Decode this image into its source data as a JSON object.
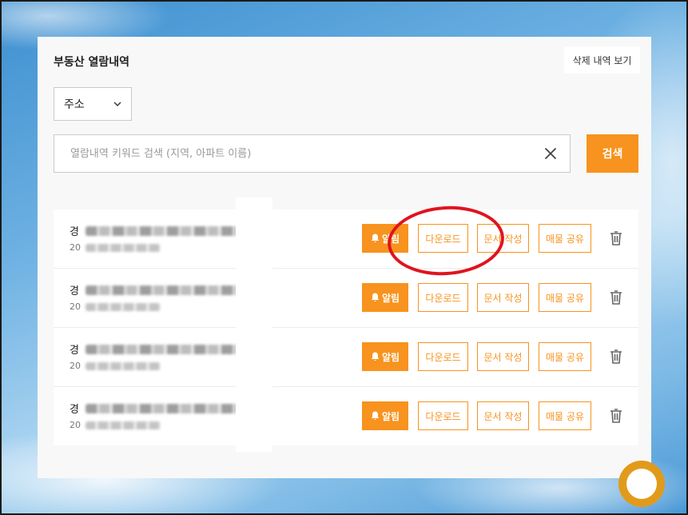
{
  "page": {
    "title": "부동산 열람내역",
    "deleted_history_label": "삭제 내역 보기"
  },
  "filter": {
    "selected": "주소"
  },
  "search": {
    "placeholder": "열람내역 키워드 검색 (지역, 아파트 이름)",
    "value": "",
    "button_label": "검색"
  },
  "records": [
    {
      "address_prefix": "경",
      "date_prefix": "20"
    },
    {
      "address_prefix": "경",
      "date_prefix": "20"
    },
    {
      "address_prefix": "경",
      "date_prefix": "20"
    },
    {
      "address_prefix": "경",
      "date_prefix": "20"
    }
  ],
  "row_actions": {
    "alarm_label": "알림",
    "download_label": "다운로드",
    "write_doc_label": "문서 작성",
    "share_label": "매물 공유"
  },
  "icons": {
    "select": "chevron-down-icon",
    "clear": "close-icon",
    "alarm": "bell-icon",
    "delete": "trash-icon"
  },
  "colors": {
    "accent": "#f7931e",
    "annotation": "#e0141e"
  }
}
